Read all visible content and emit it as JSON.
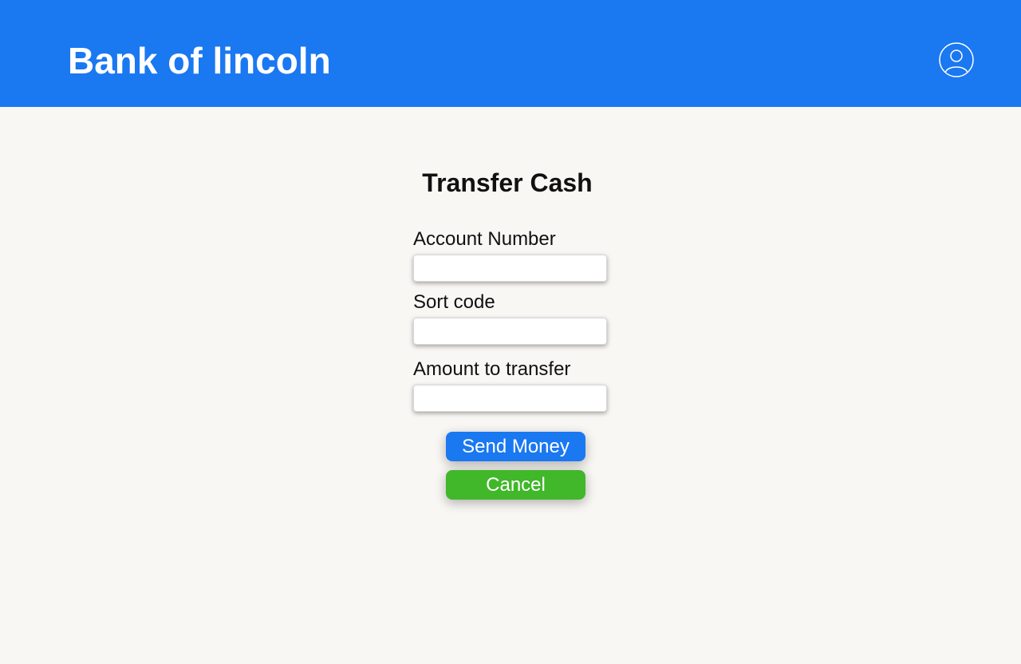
{
  "header": {
    "brand": "Bank of lincoln",
    "profile_icon": "user-circle-icon",
    "background_color": "#1a78f1"
  },
  "form": {
    "title": "Transfer Cash",
    "fields": [
      {
        "label": "Account Number",
        "value": "",
        "placeholder": ""
      },
      {
        "label": "Sort code",
        "value": "",
        "placeholder": ""
      },
      {
        "label": "Amount to transfer",
        "value": "",
        "placeholder": ""
      }
    ],
    "send_label": "Send Money",
    "cancel_label": "Cancel",
    "send_color": "#1a78f1",
    "cancel_color": "#41b72a"
  }
}
